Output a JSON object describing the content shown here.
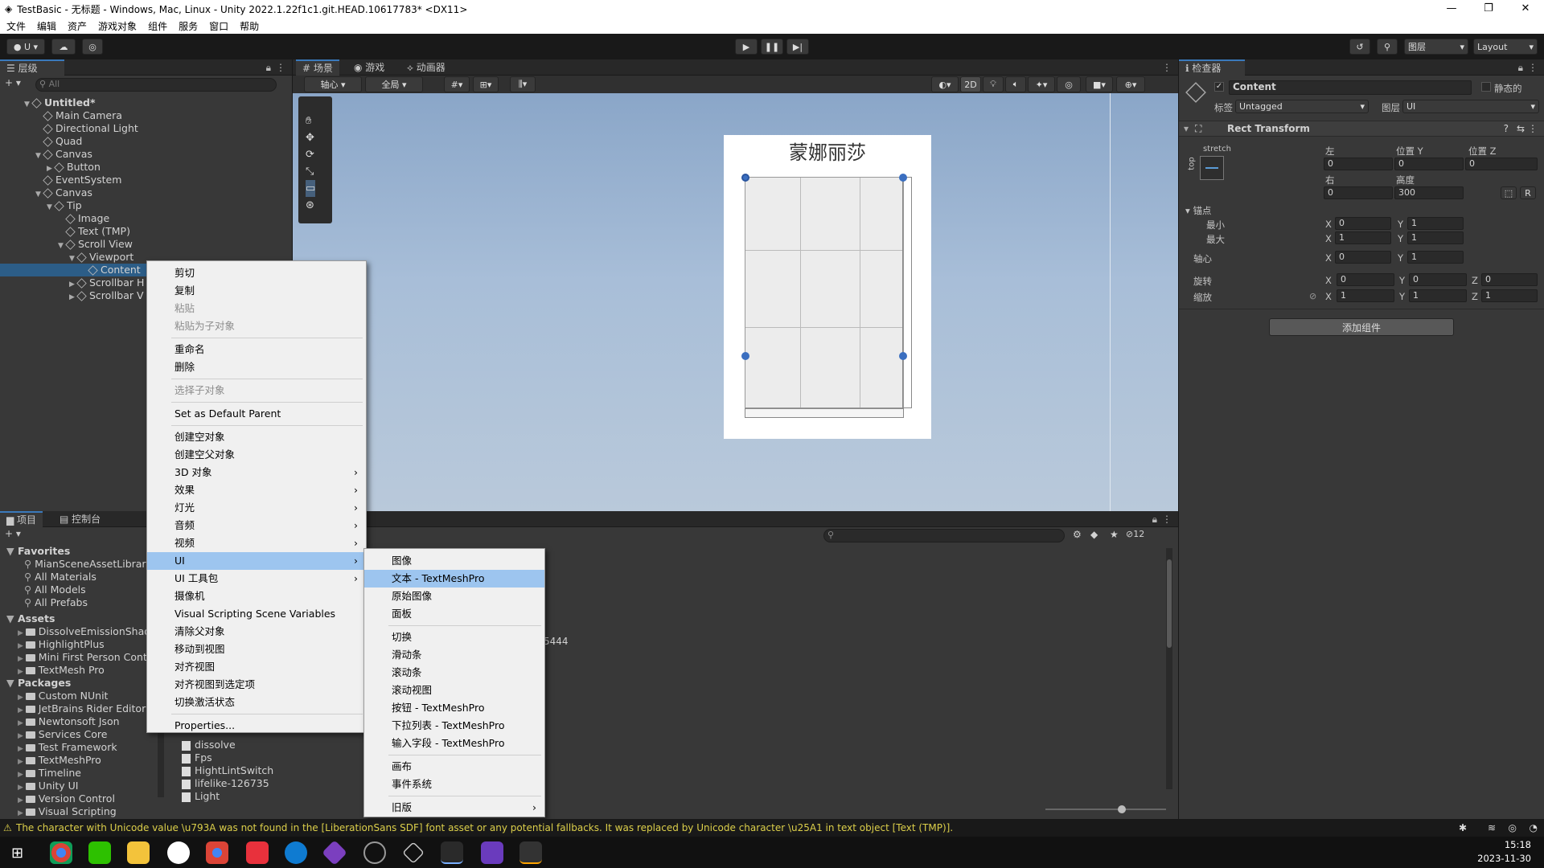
{
  "window": {
    "title": "TestBasic - 无标题 - Windows, Mac, Linux - Unity 2022.1.22f1c1.git.HEAD.10617783* <DX11>",
    "controls": [
      "—",
      "❐",
      "✕"
    ]
  },
  "menubar": [
    "文件",
    "编辑",
    "资产",
    "游戏对象",
    "组件",
    "服务",
    "窗口",
    "帮助"
  ],
  "toolbar": {
    "account": "U",
    "layers": "图层",
    "layout": "Layout"
  },
  "hierarchy": {
    "tab": "层级",
    "search_placeholder": "All",
    "items": [
      {
        "label": "Untitled*",
        "depth": 0,
        "expanded": true,
        "scene": true
      },
      {
        "label": "Main Camera",
        "depth": 1
      },
      {
        "label": "Directional Light",
        "depth": 1
      },
      {
        "label": "Quad",
        "depth": 1
      },
      {
        "label": "Canvas",
        "depth": 1,
        "expanded": true
      },
      {
        "label": "Button",
        "depth": 2,
        "collapsed": true
      },
      {
        "label": "EventSystem",
        "depth": 1
      },
      {
        "label": "Canvas",
        "depth": 1,
        "expanded": true
      },
      {
        "label": "Tip",
        "depth": 2,
        "expanded": true
      },
      {
        "label": "Image",
        "depth": 3
      },
      {
        "label": "Text (TMP)",
        "depth": 3
      },
      {
        "label": "Scroll View",
        "depth": 3,
        "expanded": true
      },
      {
        "label": "Viewport",
        "depth": 4,
        "expanded": true
      },
      {
        "label": "Content",
        "depth": 5,
        "selected": true
      },
      {
        "label": "Scrollbar H",
        "depth": 4,
        "collapsed": true
      },
      {
        "label": "Scrollbar V",
        "depth": 4,
        "collapsed": true
      }
    ]
  },
  "scene_tabs": [
    "场景",
    "游戏",
    "动画器"
  ],
  "scene_toolbar": {
    "pivot": "轴心",
    "global": "全局",
    "mode_2d": "2D"
  },
  "scene": {
    "panel_title": "蒙娜丽莎"
  },
  "inspector": {
    "tab": "检查器",
    "object_name": "Content",
    "static_label": "静态的",
    "tag_label": "标签",
    "tag_value": "Untagged",
    "layer_label": "图层",
    "layer_value": "UI",
    "component": "Rect Transform",
    "stretch": "stretch",
    "top": "top",
    "labels": {
      "left": "左",
      "pos_y": "位置 Y",
      "pos_z": "位置 Z",
      "right": "右",
      "height": "高度",
      "anchors": "锚点",
      "min": "最小",
      "max": "最大",
      "pivot": "轴心",
      "rotation": "旋转",
      "scale": "缩放"
    },
    "values": {
      "left": "0",
      "pos_y": "0",
      "pos_z": "0",
      "right": "0",
      "height": "300",
      "min_x": "0",
      "min_y": "1",
      "max_x": "1",
      "max_y": "1",
      "pivot_x": "0",
      "pivot_y": "1",
      "rot_x": "0",
      "rot_y": "0",
      "rot_z": "0",
      "scale_x": "1",
      "scale_y": "1",
      "scale_z": "1"
    },
    "add_component": "添加组件"
  },
  "project": {
    "tabs": [
      "项目",
      "控制台"
    ],
    "badge": "12",
    "favorites_label": "Favorites",
    "favorites": [
      "MianSceneAssetLibrary",
      "All Materials",
      "All Models",
      "All Prefabs"
    ],
    "assets_label": "Assets",
    "assets": [
      "DissolveEmissionShade",
      "HighlightPlus",
      "Mini First Person Contr",
      "TextMesh Pro"
    ],
    "packages_label": "Packages",
    "packages": [
      "Custom NUnit",
      "JetBrains Rider Editor",
      "Newtonsoft Json",
      "Services Core",
      "Test Framework",
      "TextMeshPro",
      "Timeline",
      "Unity UI",
      "Version Control",
      "Visual Scripting"
    ],
    "files": [
      "dissolve",
      "Fps",
      "HightLintSwitch",
      "lifelike-126735",
      "Light"
    ],
    "snippet": "5444"
  },
  "context_menu": {
    "items": [
      {
        "label": "剪切"
      },
      {
        "label": "复制"
      },
      {
        "label": "粘贴",
        "disabled": true
      },
      {
        "label": "粘贴为子对象",
        "disabled": true
      },
      {
        "sep": true
      },
      {
        "label": "重命名"
      },
      {
        "label": "删除"
      },
      {
        "sep": true
      },
      {
        "label": "选择子对象",
        "disabled": true
      },
      {
        "sep": true
      },
      {
        "label": "Set as Default Parent"
      },
      {
        "sep": true
      },
      {
        "label": "创建空对象"
      },
      {
        "label": "创建空父对象"
      },
      {
        "label": "3D 对象",
        "sub": true
      },
      {
        "label": "效果",
        "sub": true
      },
      {
        "label": "灯光",
        "sub": true
      },
      {
        "label": "音频",
        "sub": true
      },
      {
        "label": "视频",
        "sub": true
      },
      {
        "label": "UI",
        "sub": true,
        "highlight": true
      },
      {
        "label": "UI 工具包",
        "sub": true
      },
      {
        "label": "摄像机"
      },
      {
        "label": "Visual Scripting Scene Variables"
      },
      {
        "label": "清除父对象"
      },
      {
        "label": "移动到视图"
      },
      {
        "label": "对齐视图"
      },
      {
        "label": "对齐视图到选定项"
      },
      {
        "label": "切换激活状态"
      },
      {
        "sep": true
      },
      {
        "label": "Properties..."
      }
    ]
  },
  "ui_submenu": {
    "items": [
      {
        "label": "图像"
      },
      {
        "label": "文本 - TextMeshPro",
        "highlight": true
      },
      {
        "label": "原始图像"
      },
      {
        "label": "面板"
      },
      {
        "sep": true
      },
      {
        "label": "切换"
      },
      {
        "label": "滑动条"
      },
      {
        "label": "滚动条"
      },
      {
        "label": "滚动视图"
      },
      {
        "label": "按钮 - TextMeshPro"
      },
      {
        "label": "下拉列表 - TextMeshPro"
      },
      {
        "label": "输入字段 - TextMeshPro"
      },
      {
        "sep": true
      },
      {
        "label": "画布"
      },
      {
        "label": "事件系统"
      },
      {
        "sep": true
      },
      {
        "label": "旧版",
        "sub": true
      }
    ]
  },
  "status": {
    "message": "The character with Unicode value \\u793A was not found in the [LiberationSans SDF] font asset or any potential fallbacks. It was replaced by Unicode character \\u25A1 in text object [Text (TMP)]."
  },
  "clock": {
    "time": "15:18",
    "date": "2023-11-30"
  },
  "colors": {
    "accent": "#3a79bb",
    "selection": "#2c5d87",
    "menu_highlight": "#9dc5ef",
    "warning": "#dccf4a"
  }
}
